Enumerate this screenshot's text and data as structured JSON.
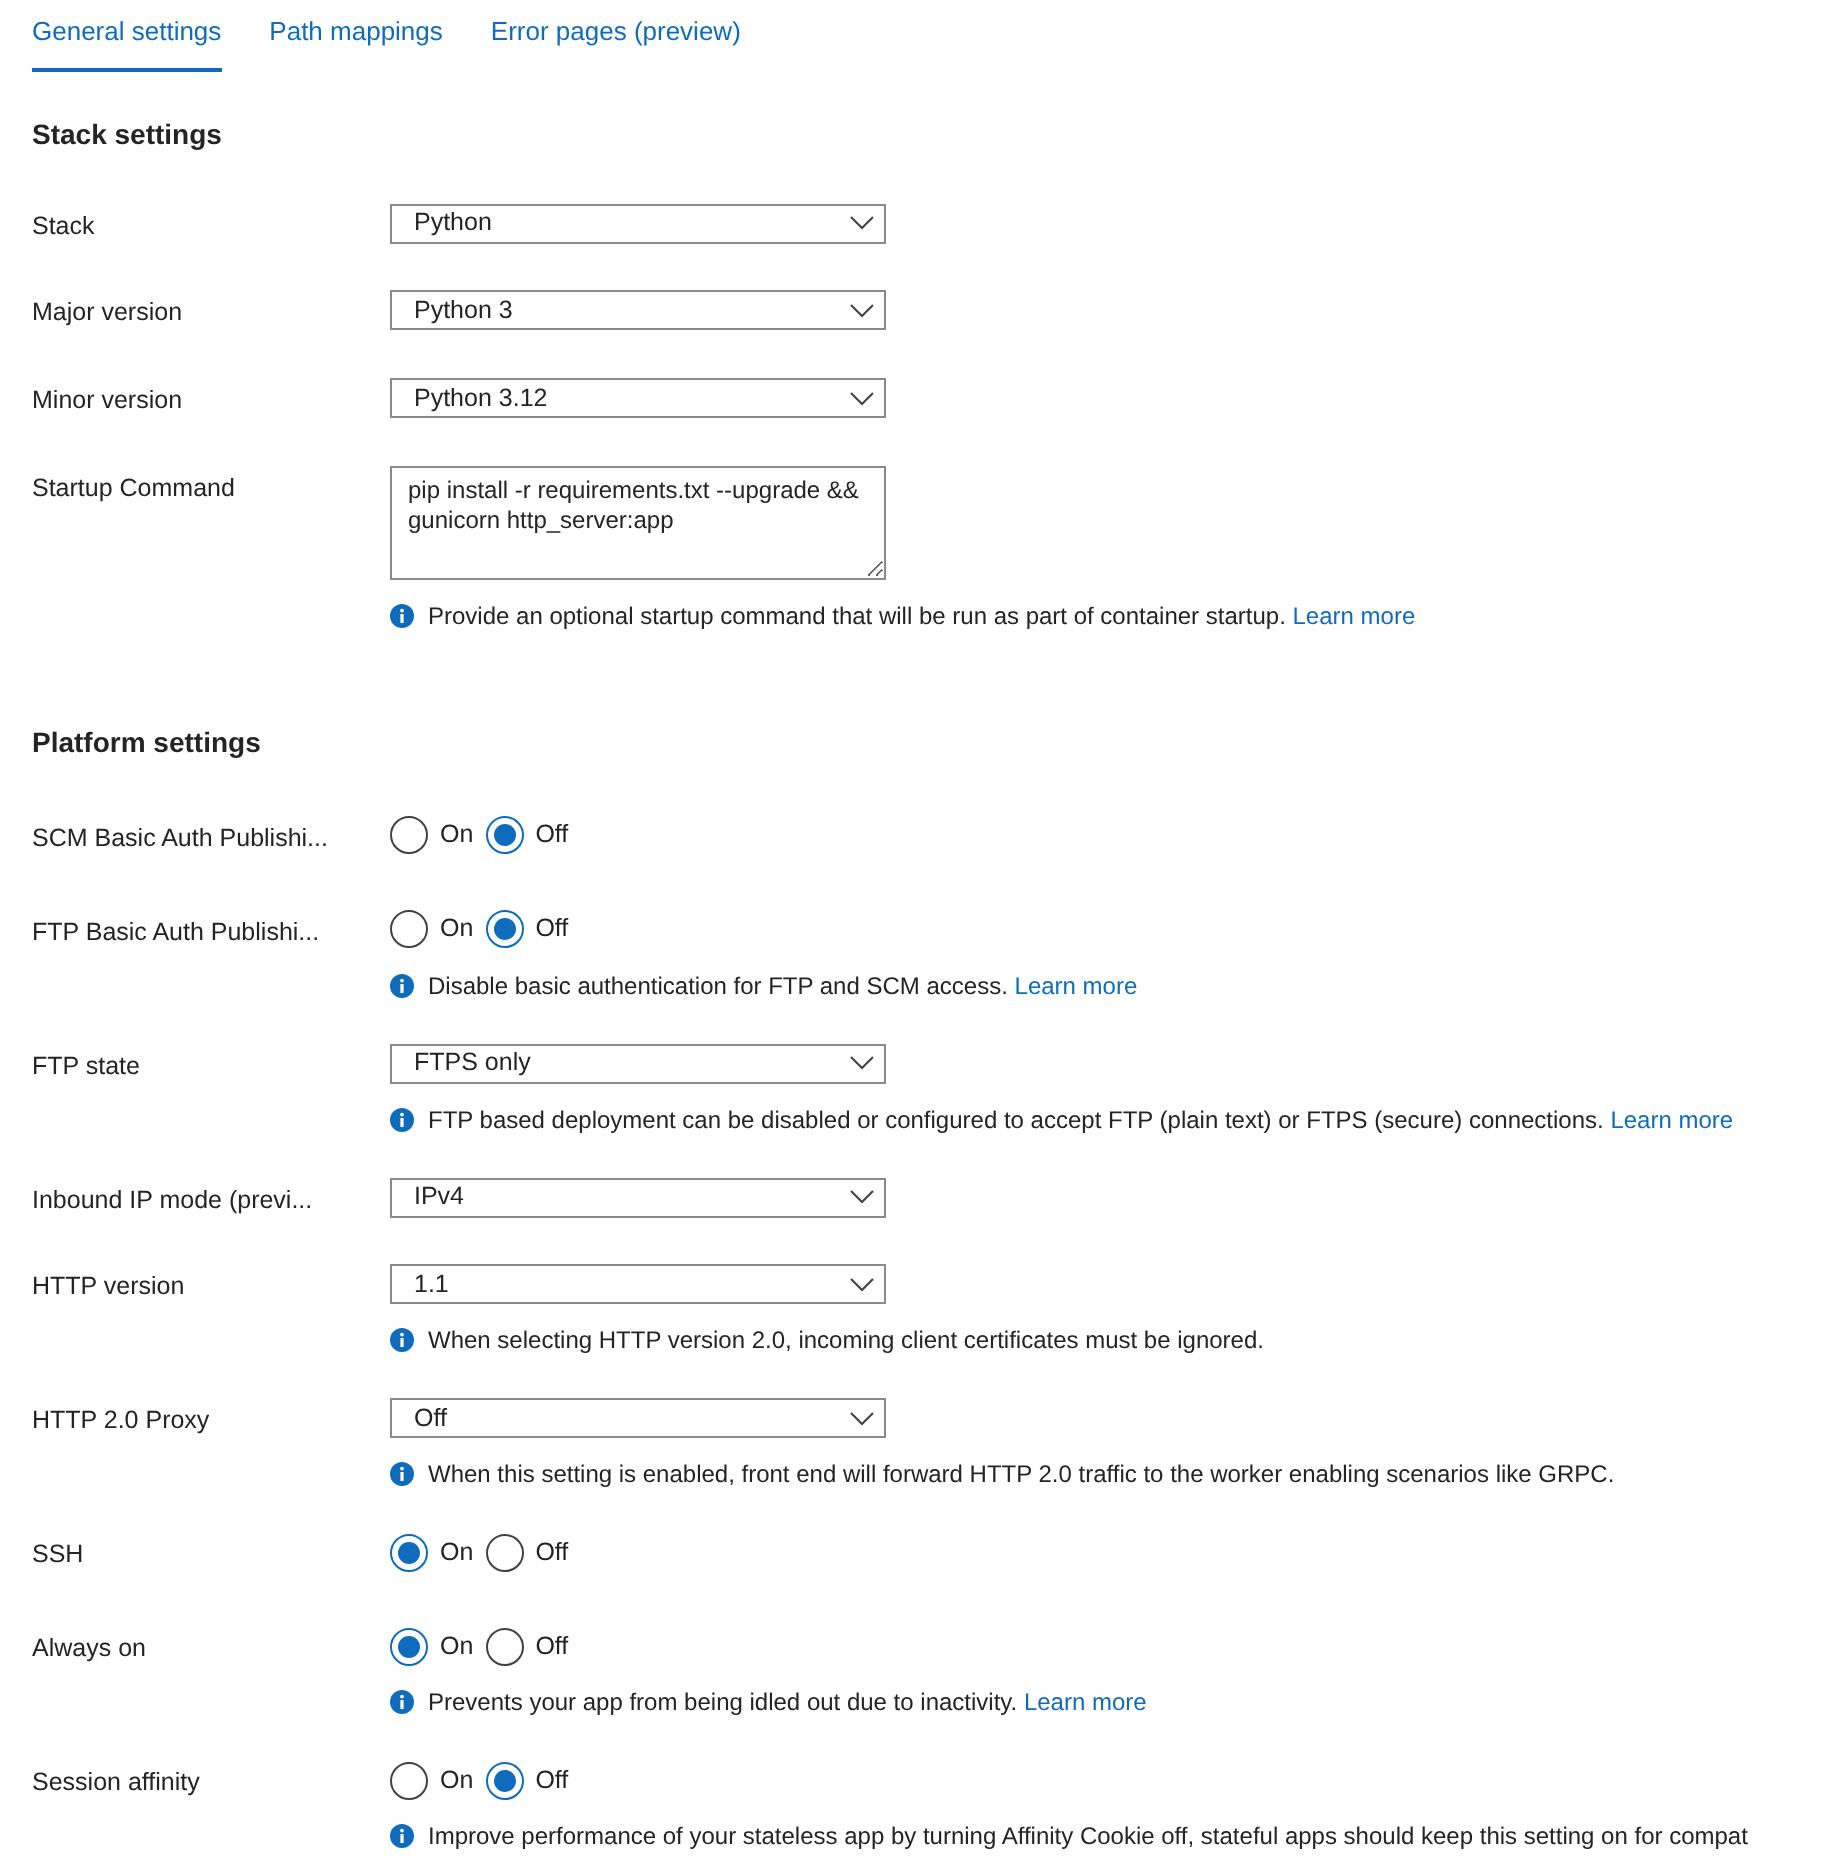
{
  "tabs": [
    {
      "label": "General settings",
      "selected": true
    },
    {
      "label": "Path mappings",
      "selected": false
    },
    {
      "label": "Error pages (preview)",
      "selected": false
    }
  ],
  "sections": [
    {
      "heading": "Stack settings",
      "rows": [
        {
          "label": "Stack",
          "kind": "dropdown",
          "value": "Python"
        },
        {
          "label": "Major version",
          "kind": "dropdown",
          "value": "Python 3"
        },
        {
          "label": "Minor version",
          "kind": "dropdown",
          "value": "Python 3.12"
        },
        {
          "label": "Startup Command",
          "kind": "textarea",
          "value": "pip install -r requirements.txt --upgrade && gunicorn http_server:app",
          "info": {
            "text": "Provide an optional startup command that will be run as part of container startup.",
            "link": "Learn more"
          }
        }
      ]
    },
    {
      "heading": "Platform settings",
      "rows": [
        {
          "label": "SCM Basic Auth Publishi...",
          "kind": "radio",
          "options": [
            {
              "label": "On",
              "selected": false
            },
            {
              "label": "Off",
              "selected": true
            }
          ]
        },
        {
          "label": "FTP Basic Auth Publishi...",
          "kind": "radio",
          "options": [
            {
              "label": "On",
              "selected": false
            },
            {
              "label": "Off",
              "selected": true
            }
          ],
          "info": {
            "text": "Disable basic authentication for FTP and SCM access.",
            "link": "Learn more"
          }
        },
        {
          "label": "FTP state",
          "kind": "dropdown",
          "value": "FTPS only",
          "info": {
            "text": "FTP based deployment can be disabled or configured to accept FTP (plain text) or FTPS (secure) connections.",
            "link": "Learn more"
          }
        },
        {
          "label": "Inbound IP mode (previ...",
          "kind": "dropdown",
          "value": "IPv4"
        },
        {
          "label": "HTTP version",
          "kind": "dropdown",
          "value": "1.1",
          "info": {
            "text": "When selecting HTTP version 2.0, incoming client certificates must be ignored."
          }
        },
        {
          "label": "HTTP 2.0 Proxy",
          "kind": "dropdown",
          "value": "Off",
          "info": {
            "text": "When this setting is enabled, front end will forward HTTP 2.0 traffic to the worker enabling scenarios like GRPC."
          }
        },
        {
          "label": "SSH",
          "kind": "radio",
          "options": [
            {
              "label": "On",
              "selected": true
            },
            {
              "label": "Off",
              "selected": false
            }
          ]
        },
        {
          "label": "Always on",
          "kind": "radio",
          "options": [
            {
              "label": "On",
              "selected": true
            },
            {
              "label": "Off",
              "selected": false
            }
          ],
          "info": {
            "text": "Prevents your app from being idled out due to inactivity.",
            "link": "Learn more"
          }
        },
        {
          "label": "Session affinity",
          "kind": "radio",
          "options": [
            {
              "label": "On",
              "selected": false
            },
            {
              "label": "Off",
              "selected": true
            }
          ],
          "info": {
            "text": "Improve performance of your stateless app by turning Affinity Cookie off, stateful apps should keep this setting on for compat"
          }
        }
      ]
    }
  ]
}
